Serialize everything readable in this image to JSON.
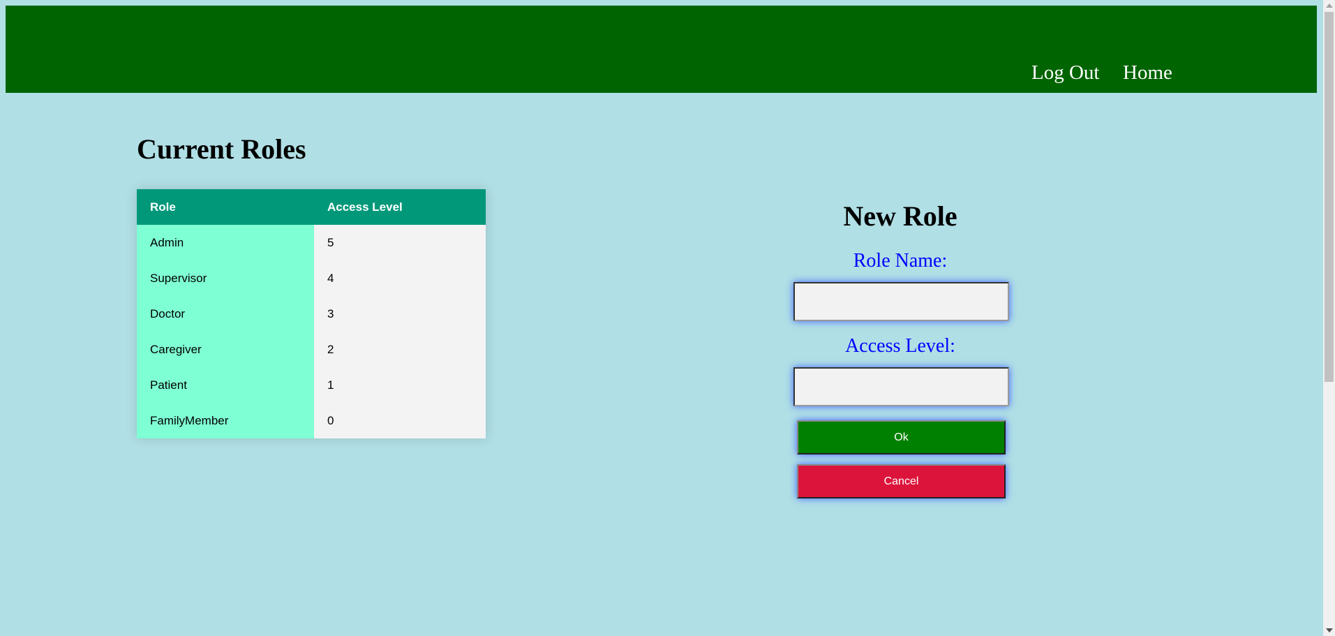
{
  "header": {
    "nav": {
      "logout_label": "Log Out",
      "home_label": "Home"
    },
    "color": "#006400"
  },
  "roles": {
    "title": "Current Roles",
    "columns": [
      "Role",
      "Access Level"
    ],
    "rows": [
      {
        "role": "Admin",
        "level": "5"
      },
      {
        "role": "Supervisor",
        "level": "4"
      },
      {
        "role": "Doctor",
        "level": "3"
      },
      {
        "role": "Caregiver",
        "level": "2"
      },
      {
        "role": "Patient",
        "level": "1"
      },
      {
        "role": "FamilyMember",
        "level": "0"
      }
    ],
    "header_color": "#009879",
    "role_cell_color": "#7fffd4"
  },
  "new_role_form": {
    "title": "New Role",
    "role_name_label": "Role Name:",
    "role_name_value": "",
    "access_level_label": "Access Level:",
    "access_level_value": "",
    "ok_label": "Ok",
    "cancel_label": "Cancel",
    "ok_color": "#008000",
    "cancel_color": "#dc143c",
    "label_color": "#0000ff"
  },
  "page": {
    "background": "#b0dfe5"
  }
}
